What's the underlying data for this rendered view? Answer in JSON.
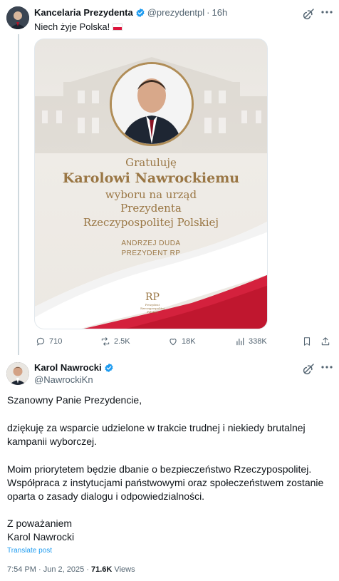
{
  "tweet1": {
    "author_name": "Kancelaria Prezydenta",
    "handle": "@prezydentpl",
    "separator": "·",
    "time": "16h",
    "text": "Niech żyje Polska!",
    "flag_icon": "poland-flag-icon",
    "media": {
      "line1": "Gratuluję",
      "line2": "Karolowi Nawrockiemu",
      "line3": "wyboru na urząd",
      "line4": "Prezydenta",
      "line5": "Rzeczypospolitej Polskiej",
      "signature_name": "ANDRZEJ DUDA",
      "signature_title": "PREZYDENT RP",
      "logo_text": "RP",
      "logo_subtext_1": "Prezydent",
      "logo_subtext_2": "Rzeczypospolitej",
      "logo_subtext_3": "Polskiej",
      "accent_color": "#9a7745"
    },
    "actions": {
      "replies": "710",
      "reposts": "2.5K",
      "likes": "18K",
      "views": "338K"
    }
  },
  "tweet2": {
    "author_name": "Karol Nawrocki",
    "handle": "@NawrockiKn",
    "paragraphs": [
      "Szanowny Panie Prezydencie,",
      "dziękuję za wsparcie udzielone w trakcie trudnej i niekiedy brutalnej kampanii wyborczej.",
      "Moim priorytetem będzie dbanie o bezpieczeństwo Rzeczypospolitej. Współpraca z instytucjami państwowymi oraz społeczeństwem zostanie oparta o zasady dialogu i odpowiedzialności.",
      "Z poważaniem",
      "Karol Nawrocki"
    ],
    "translate_label": "Translate post",
    "timestamp": "7:54 PM · Jun 2, 2025 · ",
    "views_count": "71.6K",
    "views_label": " Views"
  },
  "colors": {
    "verified_blue": "#1d9bf0",
    "text_primary": "#0f1419",
    "text_secondary": "#536471",
    "flag_red": "#dc143c"
  }
}
